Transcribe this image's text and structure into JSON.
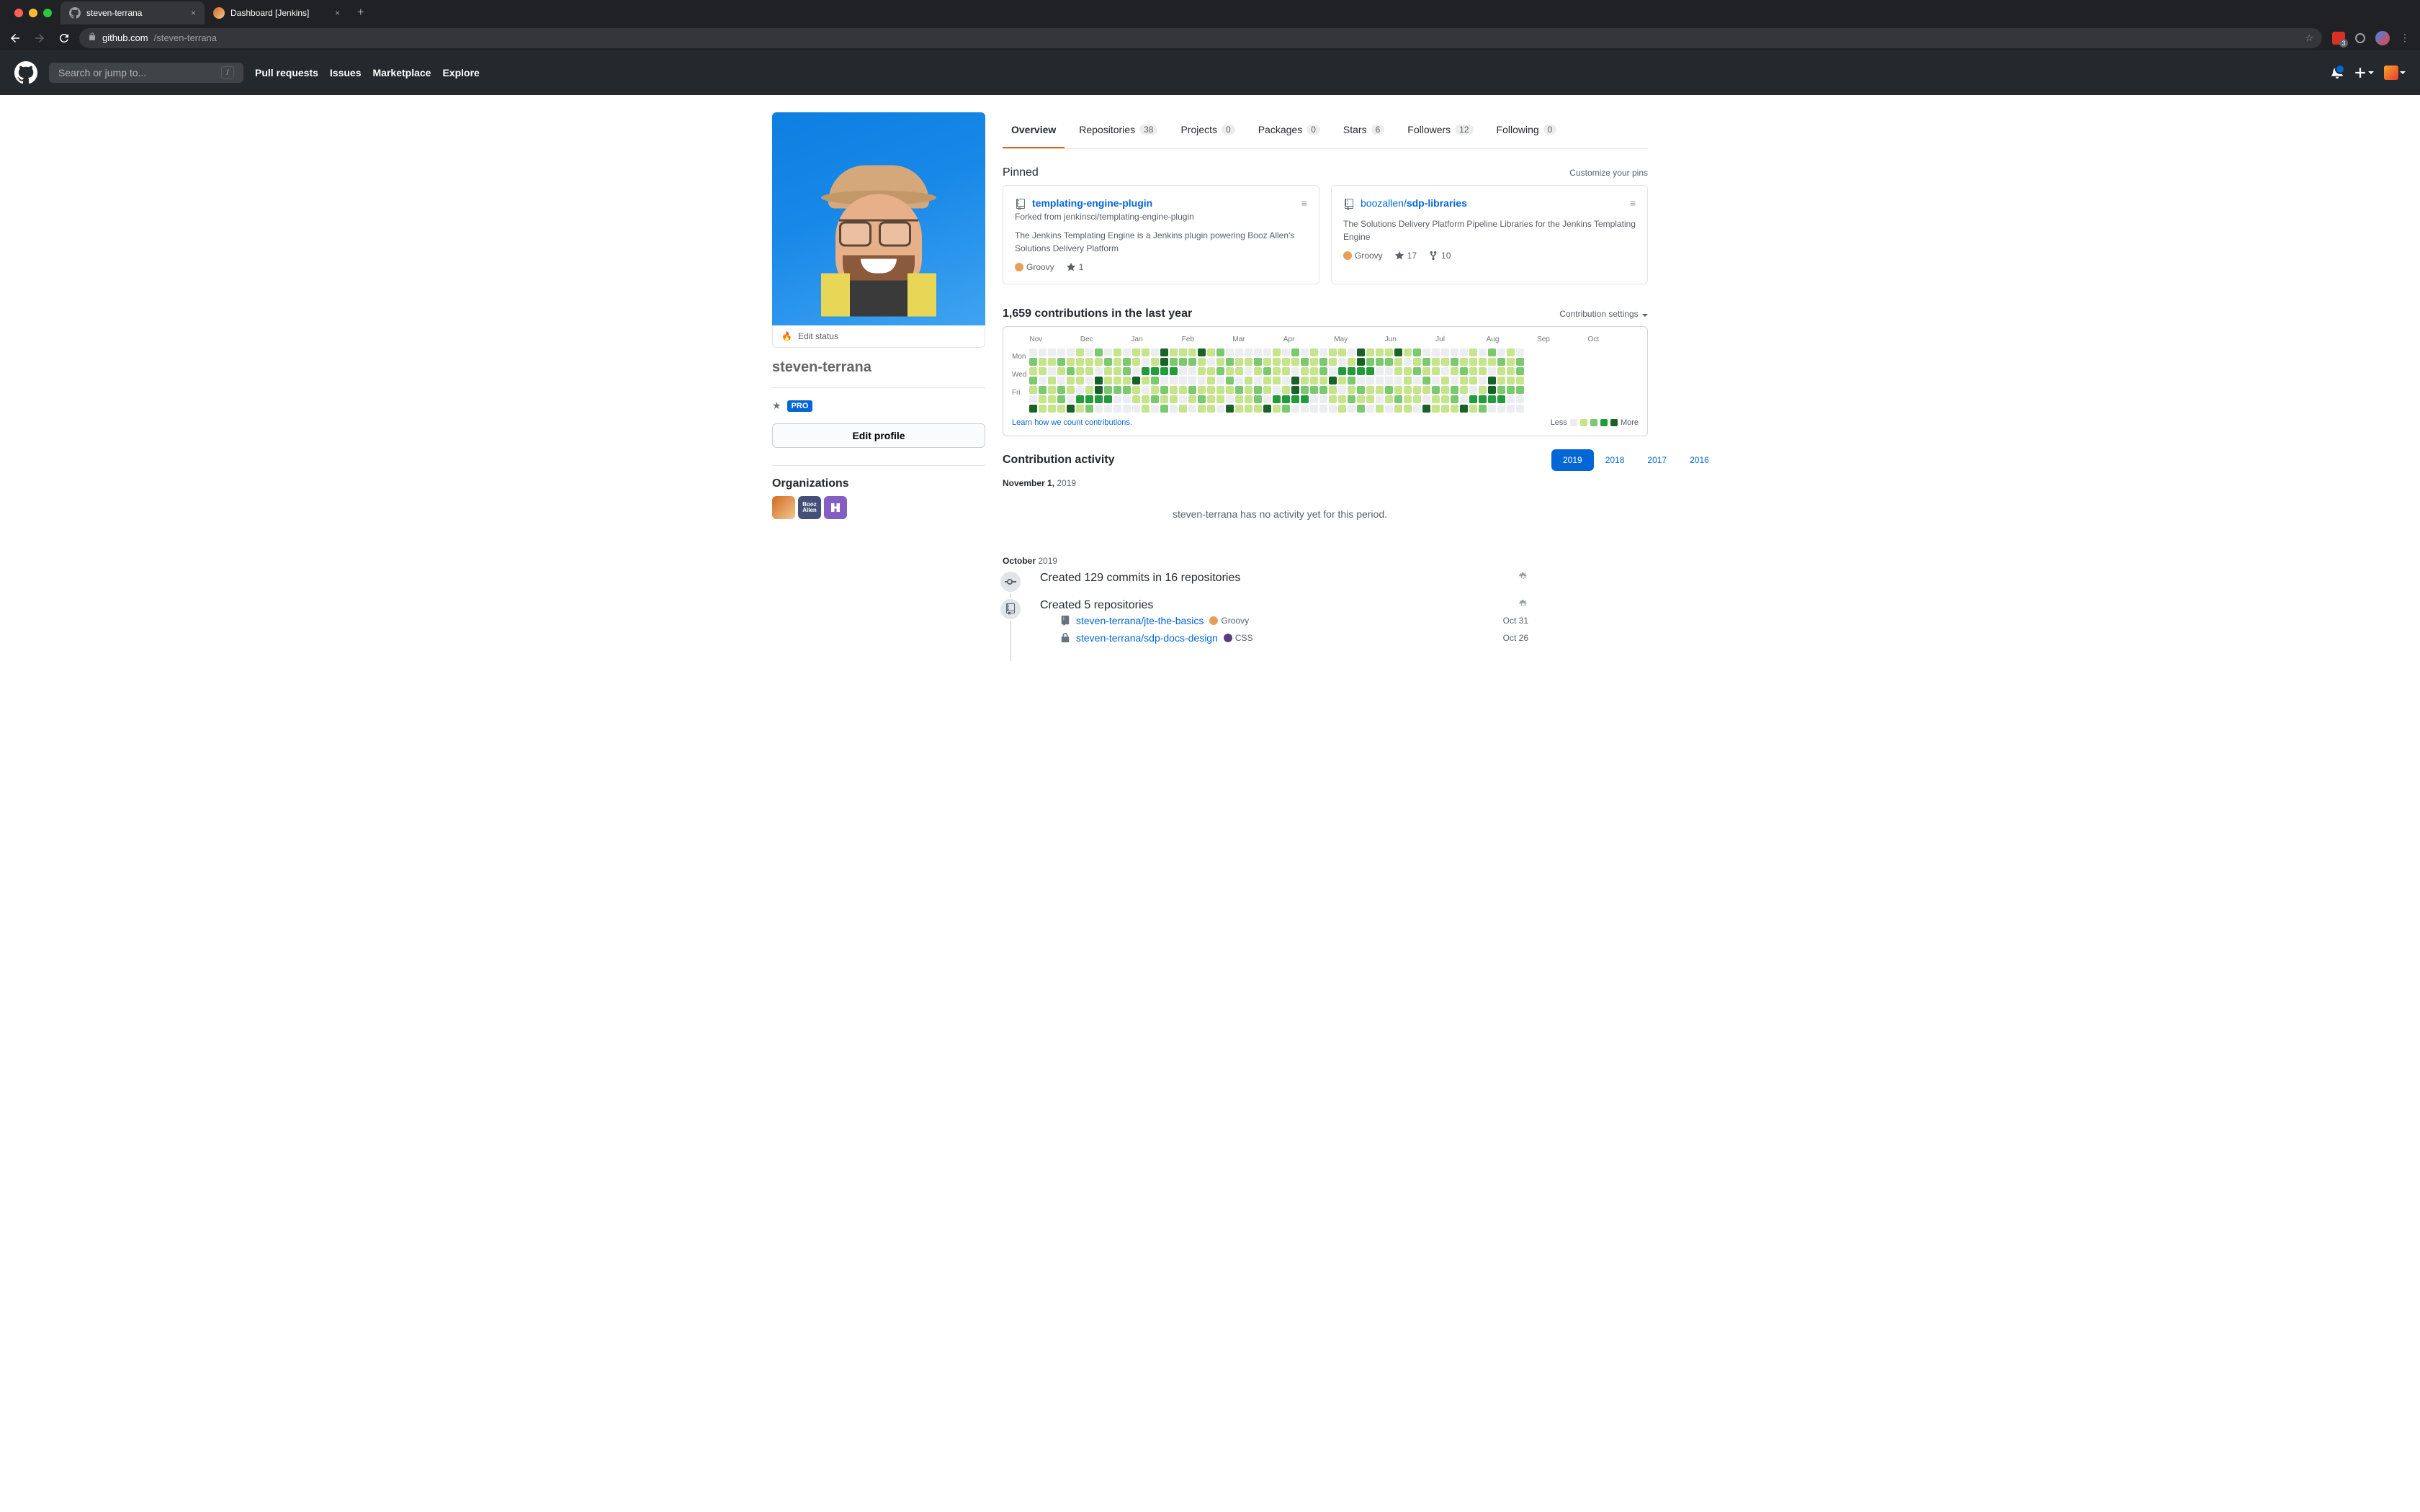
{
  "browser": {
    "tabs": [
      {
        "title": "steven-terrana",
        "active": true
      },
      {
        "title": "Dashboard [Jenkins]",
        "active": false
      }
    ],
    "url_host": "github.com",
    "url_path": "/steven-terrana",
    "ext_count": "3"
  },
  "github_header": {
    "search_placeholder": "Search or jump to...",
    "search_key": "/",
    "nav": [
      "Pull requests",
      "Issues",
      "Marketplace",
      "Explore"
    ]
  },
  "profile": {
    "status_emoji": "🔥",
    "status_text": "Edit status",
    "username": "steven-terrana",
    "pro": "PRO",
    "edit_label": "Edit profile",
    "orgs_title": "Organizations",
    "org2_text": "Booz Allen"
  },
  "profile_nav": [
    {
      "label": "Overview",
      "count": null,
      "active": true
    },
    {
      "label": "Repositories",
      "count": "38"
    },
    {
      "label": "Projects",
      "count": "0"
    },
    {
      "label": "Packages",
      "count": "0"
    },
    {
      "label": "Stars",
      "count": "6"
    },
    {
      "label": "Followers",
      "count": "12"
    },
    {
      "label": "Following",
      "count": "0"
    }
  ],
  "pinned": {
    "title": "Pinned",
    "customize": "Customize your pins",
    "cards": [
      {
        "title": "templating-engine-plugin",
        "fork_from": "Forked from jenkinsci/templating-engine-plugin",
        "desc": "The Jenkins Templating Engine is a Jenkins plugin powering Booz Allen's Solutions Delivery Platform",
        "lang": "Groovy",
        "lang_color": "#e69f56",
        "stars": "1",
        "forks": null
      },
      {
        "owner": "boozallen",
        "title": "sdp-libraries",
        "desc": "The Solutions Delivery Platform Pipeline Libraries for the Jenkins Templating Engine",
        "lang": "Groovy",
        "lang_color": "#e69f56",
        "stars": "17",
        "forks": "10"
      }
    ]
  },
  "contrib": {
    "title": "1,659 contributions in the last year",
    "settings": "Contribution settings",
    "months": [
      "Nov",
      "Dec",
      "Jan",
      "Feb",
      "Mar",
      "Apr",
      "May",
      "Jun",
      "Jul",
      "Aug",
      "Sep",
      "Oct"
    ],
    "days": [
      "Mon",
      "Wed",
      "Fri"
    ],
    "learn_link": "Learn how we count contributions.",
    "less": "Less",
    "more": "More"
  },
  "activity": {
    "title": "Contribution activity",
    "months": [
      {
        "month": "November 1,",
        "year": "2019",
        "empty": "steven-terrana has no activity yet for this period."
      },
      {
        "month": "October",
        "year": "2019",
        "commits": "Created 129 commits in 16 repositories",
        "repos_title": "Created 5 repositories",
        "repos": [
          {
            "name": "steven-terrana/jte-the-basics",
            "lang": "Groovy",
            "lang_color": "#e69f56",
            "date": "Oct 31",
            "private": false
          },
          {
            "name": "steven-terrana/sdp-docs-design",
            "lang": "CSS",
            "lang_color": "#563d7c",
            "date": "Oct 26",
            "private": true
          }
        ]
      }
    ],
    "years": [
      "2019",
      "2018",
      "2017",
      "2016"
    ]
  }
}
